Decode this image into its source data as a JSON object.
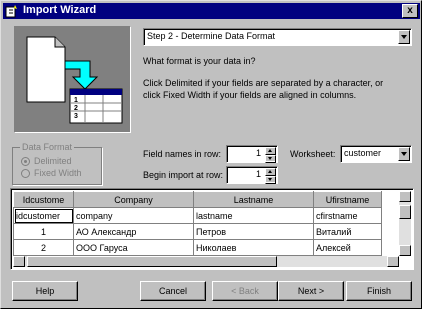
{
  "window": {
    "title": "Import Wizard",
    "close_label": "x"
  },
  "step": {
    "selected": "Step 2 - Determine Data Format"
  },
  "question": "What format is your data in?",
  "instructions": [
    "Click Delimited if your fields are separated by a character, or",
    "click Fixed Width if your fields are aligned in columns."
  ],
  "data_format": {
    "label": "Data Format",
    "options": [
      {
        "label": "Delimited",
        "selected": true
      },
      {
        "label": "Fixed Width",
        "selected": false
      }
    ]
  },
  "field_names_row": {
    "label": "Field names in row:",
    "value": "1"
  },
  "import_row": {
    "label": "Begin import at row:",
    "value": "1"
  },
  "worksheet": {
    "label": "Worksheet:",
    "value": "customer"
  },
  "grid": {
    "headers": [
      "Idcustome",
      "Company",
      "Lastname",
      "Ufirstname"
    ],
    "rows": [
      [
        "idcustomer",
        "company",
        "lastname",
        "cfirstname"
      ],
      [
        "1",
        "АО Александр",
        "Петров",
        "Виталий"
      ],
      [
        "2",
        "ООО Гаруса",
        "Николаев",
        "Алексей"
      ]
    ]
  },
  "buttons": {
    "help": "Help",
    "cancel": "Cancel",
    "back": "< Back",
    "next": "Next >",
    "finish": "Finish"
  }
}
